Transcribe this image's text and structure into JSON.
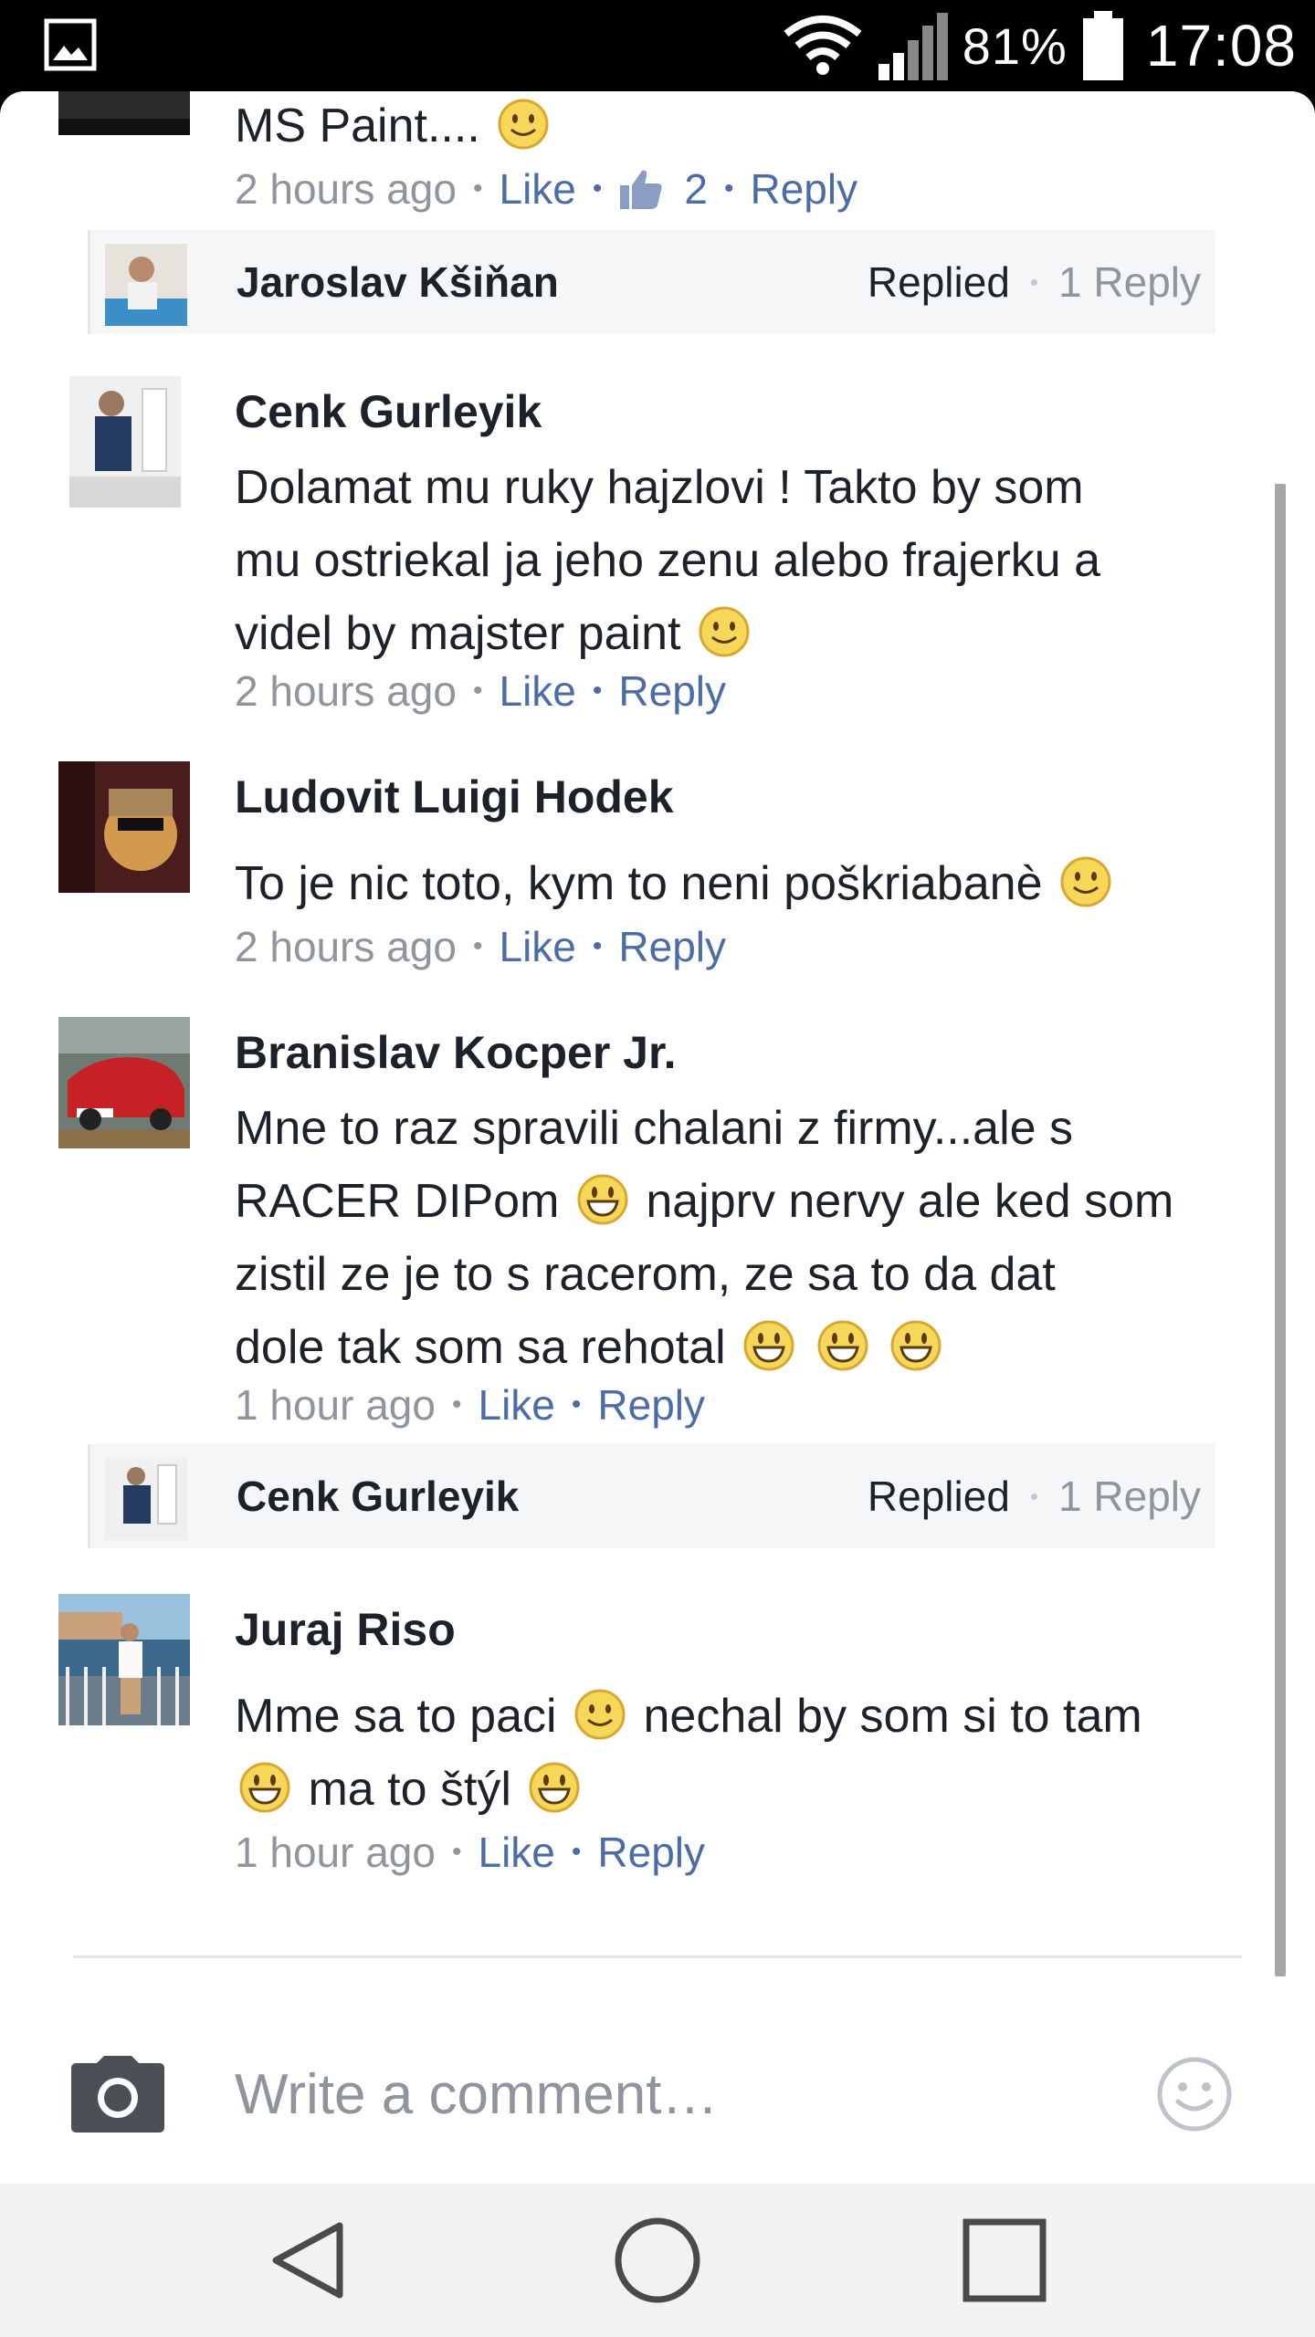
{
  "statusbar": {
    "battery": "81%",
    "time": "17:08",
    "icons": [
      "gallery-icon",
      "wifi-icon",
      "signal-icon",
      "battery-icon"
    ]
  },
  "comments": [
    {
      "text": "MS Paint....",
      "time": "2 hours ago",
      "like": "Like",
      "likes_count": "2",
      "reply": "Reply",
      "reply_strip": {
        "name": "Jaroslav Kšiňan",
        "status": "Replied",
        "count": "1 Reply"
      }
    },
    {
      "name": "Cenk Gurleyik",
      "lines": [
        "Dolamat mu ruky hajzlovi ! Takto by som",
        "mu ostriekal ja jeho zenu alebo frajerku a",
        "videl by majster paint"
      ],
      "time": "2 hours ago",
      "like": "Like",
      "reply": "Reply"
    },
    {
      "name": "Ludovit Luigi Hodek",
      "text": "To je nic toto, kym to neni poškriabanè",
      "time": "2 hours ago",
      "like": "Like",
      "reply": "Reply"
    },
    {
      "name": "Branislav Kocper Jr.",
      "lines": [
        "Mne to raz spravili chalani z firmy...ale s",
        "RACER DIPom",
        "najprv nervy ale ked som",
        "zistil ze je to s racerom, ze sa to da dat",
        "dole tak som sa rehotal"
      ],
      "time": "1 hour ago",
      "like": "Like",
      "reply": "Reply",
      "reply_strip": {
        "name": "Cenk Gurleyik",
        "status": "Replied",
        "count": "1 Reply"
      }
    },
    {
      "name": "Juraj Riso",
      "lines": [
        "Mme sa to paci",
        "nechal by som si to tam",
        "ma to štýl"
      ],
      "time": "1 hour ago",
      "like": "Like",
      "reply": "Reply"
    }
  ],
  "composer": {
    "placeholder": "Write a comment…"
  },
  "colors": {
    "link": "#4b6ca7",
    "meta": "#90949c",
    "text": "#1d2129",
    "strip": "#f5f6f7"
  }
}
